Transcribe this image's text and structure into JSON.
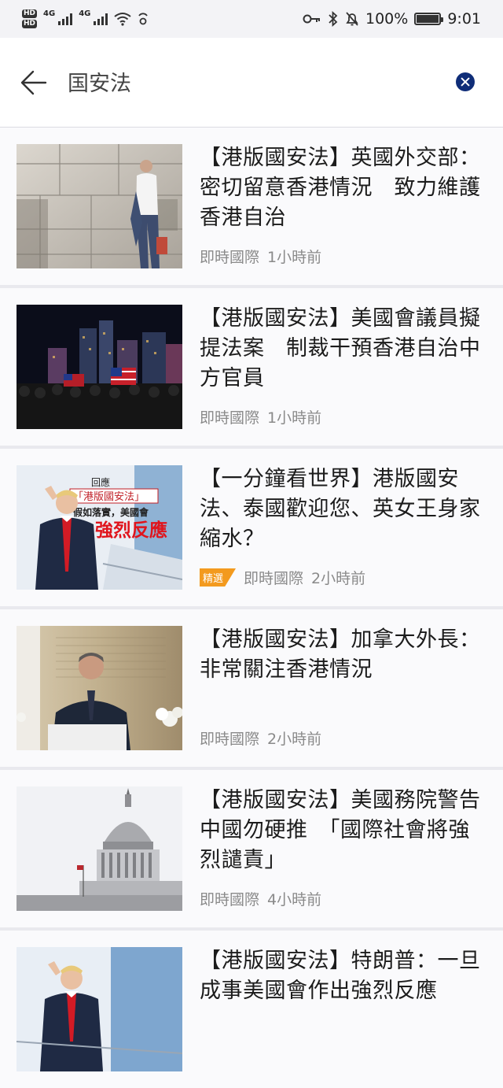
{
  "status_bar": {
    "network_a": "4G",
    "network_b": "4G",
    "battery": "100%",
    "time": "9:01"
  },
  "search": {
    "query": "国安法"
  },
  "articles": [
    {
      "title": "【港版國安法】英國外交部：密切留意香港情況　致力維護香港自治",
      "category": "即時國際",
      "time": "1小時前",
      "tag": ""
    },
    {
      "title": "【港版國安法】美國會議員擬提法案　制裁干預香港自治中方官員",
      "category": "即時國際",
      "time": "1小時前",
      "tag": ""
    },
    {
      "title": "【一分鐘看世界】港版國安法、泰國歡迎您、英女王身家縮水？",
      "category": "即時國際",
      "time": "2小時前",
      "tag": "精選",
      "thumb_caption_1": "回應",
      "thumb_caption_2": "「港版國安法」",
      "thumb_caption_3": "假如落實，美國會",
      "thumb_caption_4": "強烈反應"
    },
    {
      "title": "【港版國安法】加拿大外長：非常關注香港情況",
      "category": "即時國際",
      "time": "2小時前",
      "tag": ""
    },
    {
      "title": "【港版國安法】美國務院警告中國勿硬推　「國際社會將強烈譴責」",
      "category": "即時國際",
      "time": "4小時前",
      "tag": ""
    },
    {
      "title": "【港版國安法】特朗普：一旦成事美國會作出強烈反應",
      "category": "",
      "time": "",
      "tag": ""
    }
  ],
  "colors": {
    "accent": "#0f2d78",
    "tag": "#f39a1e",
    "meta_text": "#8a8a8a"
  }
}
